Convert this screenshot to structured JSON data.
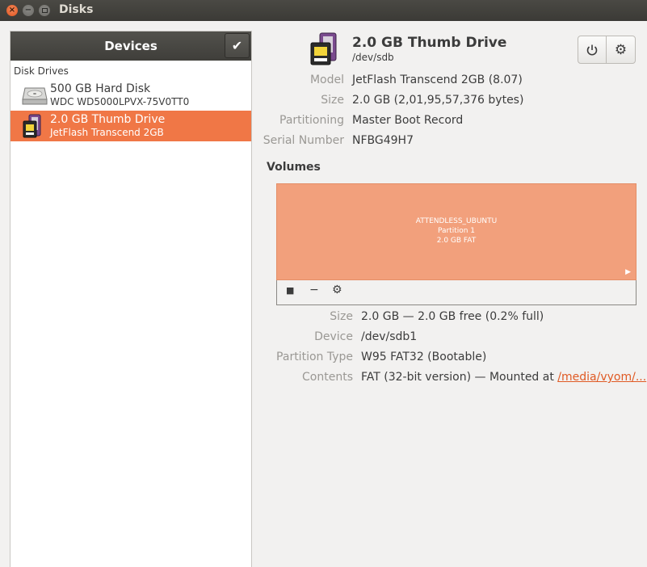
{
  "window": {
    "title": "Disks"
  },
  "sidebar": {
    "header": "Devices",
    "section": "Disk Drives",
    "drives": [
      {
        "name": "500 GB Hard Disk",
        "model": "WDC WD5000LPVX-75V0TT0",
        "icon": "hard-disk-icon",
        "selected": false
      },
      {
        "name": "2.0 GB Thumb Drive",
        "model": "JetFlash Transcend 2GB",
        "icon": "thumb-drive-icon",
        "selected": true
      }
    ]
  },
  "device": {
    "title": "2.0 GB Thumb Drive",
    "path": "/dev/sdb",
    "properties": {
      "model_label": "Model",
      "model": "JetFlash Transcend 2GB (8.07)",
      "size_label": "Size",
      "size": "2.0 GB (2,01,95,57,376 bytes)",
      "partitioning_label": "Partitioning",
      "partitioning": "Master Boot Record",
      "serial_label": "Serial Number",
      "serial": "NFBG49H7"
    }
  },
  "volumes": {
    "heading": "Volumes",
    "partition": {
      "label": "ATTENDLESS_UBUNTU",
      "name": "Partition 1",
      "info": "2.0 GB FAT"
    },
    "details": {
      "size_label": "Size",
      "size": "2.0 GB — 2.0 GB free (0.2% full)",
      "device_label": "Device",
      "device": "/dev/sdb1",
      "type_label": "Partition Type",
      "type": "W95 FAT32 (Bootable)",
      "contents_label": "Contents",
      "contents_prefix": "FAT (32-bit version) — Mounted at ",
      "mount_link": "/media/vyom/..."
    }
  },
  "colors": {
    "accent": "#f07746",
    "volume": "#f2a07c"
  }
}
